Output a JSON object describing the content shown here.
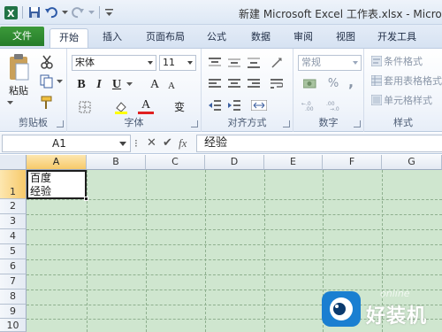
{
  "window": {
    "title": "新建 Microsoft Excel 工作表.xlsx - Micro"
  },
  "tabs": [
    {
      "label": "文件"
    },
    {
      "label": "开始"
    },
    {
      "label": "插入"
    },
    {
      "label": "页面布局"
    },
    {
      "label": "公式"
    },
    {
      "label": "数据"
    },
    {
      "label": "审阅"
    },
    {
      "label": "视图"
    },
    {
      "label": "开发工具"
    }
  ],
  "ribbon": {
    "clipboard": {
      "label": "剪贴板",
      "paste_label": "粘贴"
    },
    "font": {
      "label": "字体",
      "font_name": "宋体",
      "font_size": "11",
      "bold": "B",
      "italic": "I",
      "underline": "U",
      "grow": "A",
      "shrink": "A",
      "color_a": "A",
      "wen": "变"
    },
    "alignment": {
      "label": "对齐方式"
    },
    "number": {
      "label": "数字",
      "format": "常规",
      "percent": "%",
      "comma": ","
    },
    "styles": {
      "label": "样式",
      "conditional": "条件格式",
      "table": "套用表格格式",
      "cell": "单元格样式"
    }
  },
  "formula_bar": {
    "name_box": "A1",
    "fx": "fx",
    "content": "经验"
  },
  "columns": [
    "A",
    "B",
    "C",
    "D",
    "E",
    "F",
    "G"
  ],
  "rows": [
    "1",
    "2",
    "3",
    "4",
    "5",
    "6",
    "7",
    "8",
    "9",
    "10"
  ],
  "cells": {
    "A1_line1": "百度",
    "A1_line2": "经验"
  },
  "watermark": {
    "text": "好装机",
    "sub": "online"
  },
  "colors": {
    "file_tab": "#2e8a31",
    "sheet_bg": "#cfe6cf",
    "selected_header": "#f7c96a"
  }
}
